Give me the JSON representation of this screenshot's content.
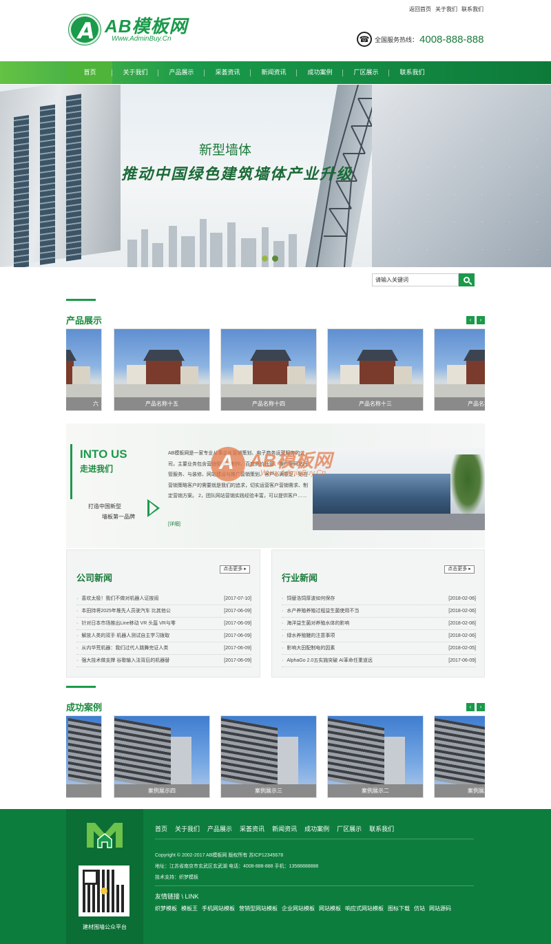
{
  "top_links": [
    "返回首页",
    "关于我们",
    "联系我们"
  ],
  "logo": {
    "main": "AB模板网",
    "sub": "Www.AdminBuy.Cn"
  },
  "hotline": {
    "label": "全国服务热线：",
    "number": "4008-888-888"
  },
  "nav": [
    "首页",
    "关于我们",
    "产品展示",
    "采荟资讯",
    "新闻资讯",
    "成功案例",
    "厂区展示",
    "联系我们"
  ],
  "banner": {
    "title": "新型墙体",
    "subtitle": "推动中国绿色建筑墙体产业升级"
  },
  "search": {
    "placeholder": "请输入关键词"
  },
  "products": {
    "title": "产品展示",
    "items": [
      "六",
      "产品名称十五",
      "产品名称十四",
      "产品名称十三",
      "产品名称十"
    ]
  },
  "about": {
    "en": "INTO US",
    "cn": "走进我们",
    "slogan1": "打造中国新型",
    "slogan2": "墙板第一品牌",
    "text": "AB模板网是一家专业从事企业营销策划、电子商务运营服务的公司，主要业务包含营销型网站制作、百度高价托管、推广型网站托管服务、与装修、网站建设与推广营销策划、客户心满意足，始在营销策略客户的需要就是我们的追求，切实运营客户营销需求、制定营销方案。 2，团队网站营销实践经验丰富，可以提供客户……",
    "more": "[详细]",
    "watermark_main": "AB模板网",
    "watermark_sub": "Www.AdminBuy.Cn"
  },
  "company_news": {
    "title": "公司新闻",
    "more": "点击更多",
    "items": [
      {
        "t": "喜欢太极！我们不做对机器人证按阅",
        "d": "[2017-07-10]"
      },
      {
        "t": "本田持将2025年推先人员驶汽车 比其他公",
        "d": "[2017-06-09]"
      },
      {
        "t": "针对日本市场推出Line移动 VR 头盔 VR与零",
        "d": "[2017-06-09]"
      },
      {
        "t": "解放人类的双手 机器人测试自主学习拨取",
        "d": "[2017-06-09]"
      },
      {
        "t": "从内华荒机器：我们过代人跳舞完证人类",
        "d": "[2017-06-09]"
      },
      {
        "t": "强大技术做支撑 谷歌输入法背后的机器替",
        "d": "[2017-06-09]"
      }
    ]
  },
  "industry_news": {
    "title": "行业新闻",
    "more": "点击更多",
    "items": [
      {
        "t": "饲替洛饲厚波如何保存",
        "d": "[2018-02-06]"
      },
      {
        "t": "水产养殖养殖过程益生菌使用不当",
        "d": "[2018-02-06]"
      },
      {
        "t": "海洋益生菌对养殖水体的影响",
        "d": "[2018-02-06]"
      },
      {
        "t": "绿水养殖鳗的注意事项",
        "d": "[2018-02-06]"
      },
      {
        "t": "影响大田配制电的因素",
        "d": "[2018-02-05]"
      },
      {
        "t": "AlphaGo 2.0五实施突破 AI革命任重道远",
        "d": "[2017-06-09]"
      }
    ]
  },
  "cases": {
    "title": "成功案例",
    "items": [
      "",
      "案例展示四",
      "案例展示三",
      "案例展示二",
      "案例展示"
    ]
  },
  "footer": {
    "nav": [
      "首页",
      "关于我们",
      "产品展示",
      "采荟资讯",
      "新闻资讯",
      "成功案例",
      "厂区展示",
      "联系我们"
    ],
    "copyright": "Copyright © 2002-2017 AB模板网 版权所有 苏ICP12345678",
    "address": "地址：江苏省南京市玄武区玄武湖 电话：4008-888-888 手机：13588888888",
    "support": "技术支持：织梦模板",
    "qr_caption": "建材围墙公众平台",
    "links_title": "友情链接 \\ LINK",
    "links": [
      "织梦模板",
      "模板王",
      "手机网站模板",
      "营销型网站模板",
      "企业网站模板",
      "网站模板",
      "响应式网站模板",
      "图标下载",
      "仿站",
      "网站源码"
    ]
  },
  "colors": {
    "brand": "#1a9a4a",
    "footer": "#0d7d3d"
  }
}
